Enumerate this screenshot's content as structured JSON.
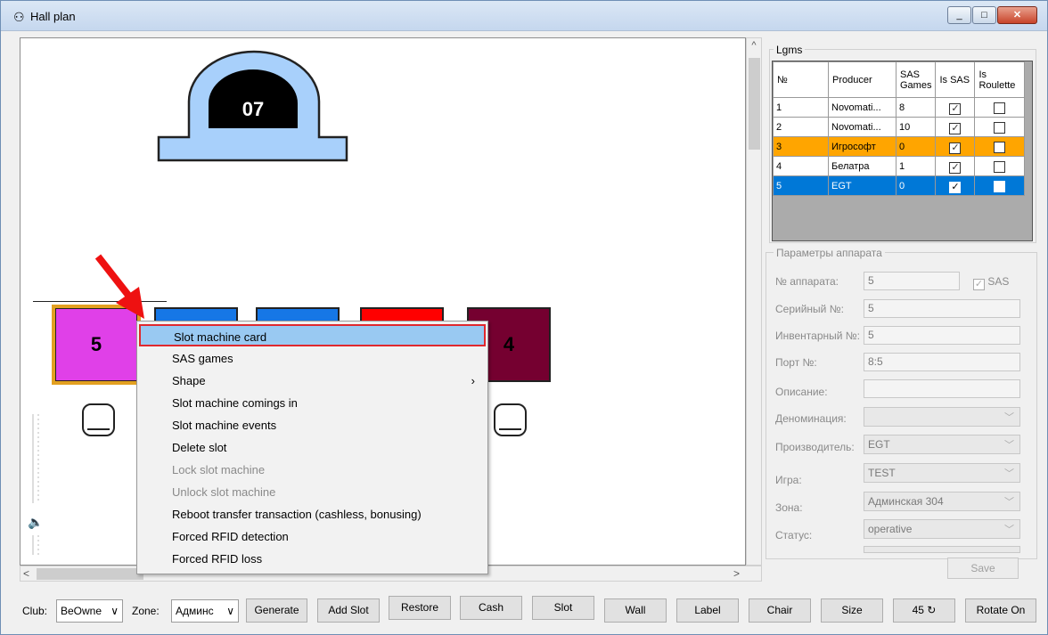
{
  "window": {
    "title": "Hall plan",
    "min": "_",
    "max": "□",
    "close": "✕"
  },
  "plan": {
    "dome_label": "07",
    "slots": [
      {
        "label": "5",
        "color": "#e040e8"
      },
      {
        "label": "",
        "color": "#1677e6"
      },
      {
        "label": "",
        "color": "#1677e6"
      },
      {
        "label": "",
        "color": "#ff0000"
      },
      {
        "label": "4",
        "color": "#750030"
      }
    ]
  },
  "context_menu": {
    "items": [
      {
        "label": "Slot machine card"
      },
      {
        "label": "SAS games"
      },
      {
        "label": "Shape",
        "submenu": "›"
      },
      {
        "label": "Slot machine comings in"
      },
      {
        "label": "Slot machine events"
      },
      {
        "label": "Delete slot"
      },
      {
        "label": "Lock slot machine"
      },
      {
        "label": "Unlock slot machine"
      },
      {
        "label": "Reboot transfer transaction (cashless, bonusing)"
      },
      {
        "label": "Forced RFID detection"
      },
      {
        "label": "Forced RFID loss"
      }
    ]
  },
  "lgms": {
    "title": "Lgms",
    "columns": [
      "№",
      "Producer",
      "SAS Games",
      "Is SAS",
      "Is Roulette"
    ],
    "rows": [
      {
        "num": "1",
        "producer": "Novomati...",
        "sas_games": "8",
        "is_sas": true,
        "is_roulette": false
      },
      {
        "num": "2",
        "producer": "Novomati...",
        "sas_games": "10",
        "is_sas": true,
        "is_roulette": false
      },
      {
        "num": "3",
        "producer": "Игрософт",
        "sas_games": "0",
        "is_sas": true,
        "is_roulette": false
      },
      {
        "num": "4",
        "producer": "Белатра",
        "sas_games": "1",
        "is_sas": true,
        "is_roulette": false
      },
      {
        "num": "5",
        "producer": "EGT",
        "sas_games": "0",
        "is_sas": true,
        "is_roulette": false
      }
    ]
  },
  "params": {
    "title": "Параметры аппарата",
    "machine_no_label": "№ аппарата:",
    "machine_no": "5",
    "sas_label": "SAS",
    "serial_label": "Серийный №:",
    "serial": "5",
    "inventory_label": "Инвентарный №:",
    "inventory": "5",
    "port_label": "Порт №:",
    "port": "8:5",
    "description_label": "Описание:",
    "description": "",
    "denomination_label": "Деноминация:",
    "denomination": "",
    "producer_label": "Производитель:",
    "producer": "EGT",
    "game_label": "Игра:",
    "game": "TEST",
    "zone_label": "Зона:",
    "zone": "Админская 304",
    "status_label": "Статус:",
    "status": "operative",
    "save": "Save"
  },
  "bottom": {
    "club_label": "Club:",
    "club": "BeOwne",
    "zone_label": "Zone:",
    "zone": "Админс",
    "buttons": [
      "Generate",
      "Add Slot",
      "Restore",
      "Cash",
      "Slot",
      "Wall",
      "Label",
      "Chair",
      "Size",
      "45 ↻",
      "Rotate On"
    ]
  }
}
